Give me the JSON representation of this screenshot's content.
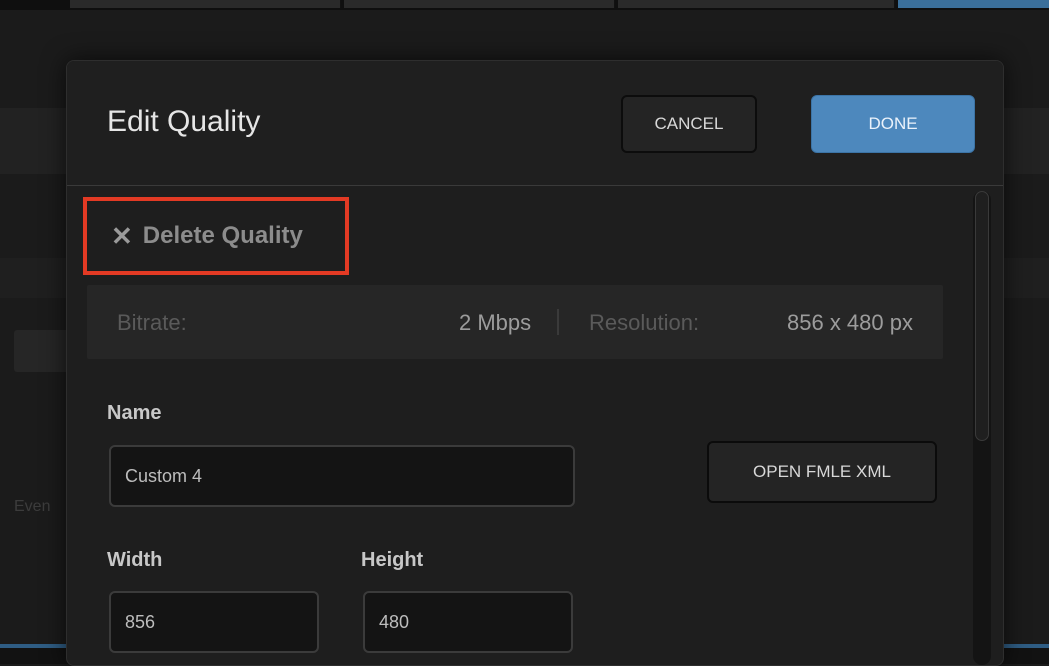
{
  "background": {
    "edge_text": "Even"
  },
  "dialog": {
    "title": "Edit Quality",
    "cancel_label": "CANCEL",
    "done_label": "DONE",
    "accent_color": "#4d88bd",
    "highlight_color": "#e33a24"
  },
  "delete": {
    "icon": "close-icon",
    "icon_glyph": "✕",
    "label": "Delete Quality"
  },
  "summary": {
    "bitrate_label": "Bitrate:",
    "bitrate_value": "2 Mbps",
    "resolution_label": "Resolution:",
    "resolution_value": "856 x 480 px"
  },
  "form": {
    "name_label": "Name",
    "name_value": "Custom 4",
    "open_xml_label": "OPEN FMLE XML",
    "width_label": "Width",
    "width_value": "856",
    "height_label": "Height",
    "height_value": "480"
  }
}
